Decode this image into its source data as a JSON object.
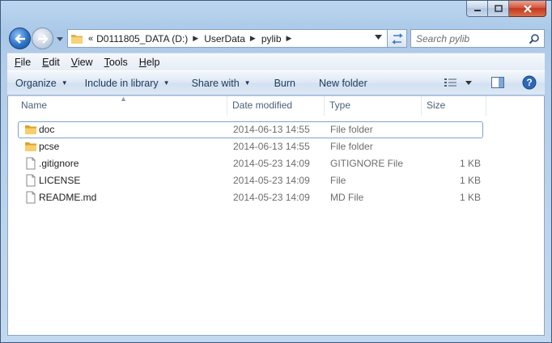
{
  "window": {
    "title": ""
  },
  "nav": {
    "breadcrumb": {
      "overflow": "«",
      "segments": [
        "D0111805_DATA (D:)",
        "UserData",
        "pylib"
      ]
    },
    "search_placeholder": "Search pylib"
  },
  "menu": {
    "items": [
      {
        "accel": "F",
        "rest": "ile"
      },
      {
        "accel": "E",
        "rest": "dit"
      },
      {
        "accel": "V",
        "rest": "iew"
      },
      {
        "accel": "T",
        "rest": "ools"
      },
      {
        "accel": "H",
        "rest": "elp"
      }
    ]
  },
  "toolbar": {
    "organize": "Organize",
    "include_in_library": "Include in library",
    "share_with": "Share with",
    "burn": "Burn",
    "new_folder": "New folder"
  },
  "columns": {
    "name": "Name",
    "date_modified": "Date modified",
    "type": "Type",
    "size": "Size"
  },
  "files": [
    {
      "name": "doc",
      "date": "2014-06-13 14:55",
      "type": "File folder",
      "size": "",
      "kind": "folder"
    },
    {
      "name": "pcse",
      "date": "2014-06-13 14:55",
      "type": "File folder",
      "size": "",
      "kind": "folder"
    },
    {
      "name": ".gitignore",
      "date": "2014-05-23 14:09",
      "type": "GITIGNORE File",
      "size": "1 KB",
      "kind": "file"
    },
    {
      "name": "LICENSE",
      "date": "2014-05-23 14:09",
      "type": "File",
      "size": "1 KB",
      "kind": "file"
    },
    {
      "name": "README.md",
      "date": "2014-05-23 14:09",
      "type": "MD File",
      "size": "1 KB",
      "kind": "file"
    }
  ],
  "colors": {
    "accent": "#2c73c7",
    "folder": "#f3c75c",
    "selection_border": "#7da2ce",
    "secondary_text": "#6d6d6d"
  }
}
